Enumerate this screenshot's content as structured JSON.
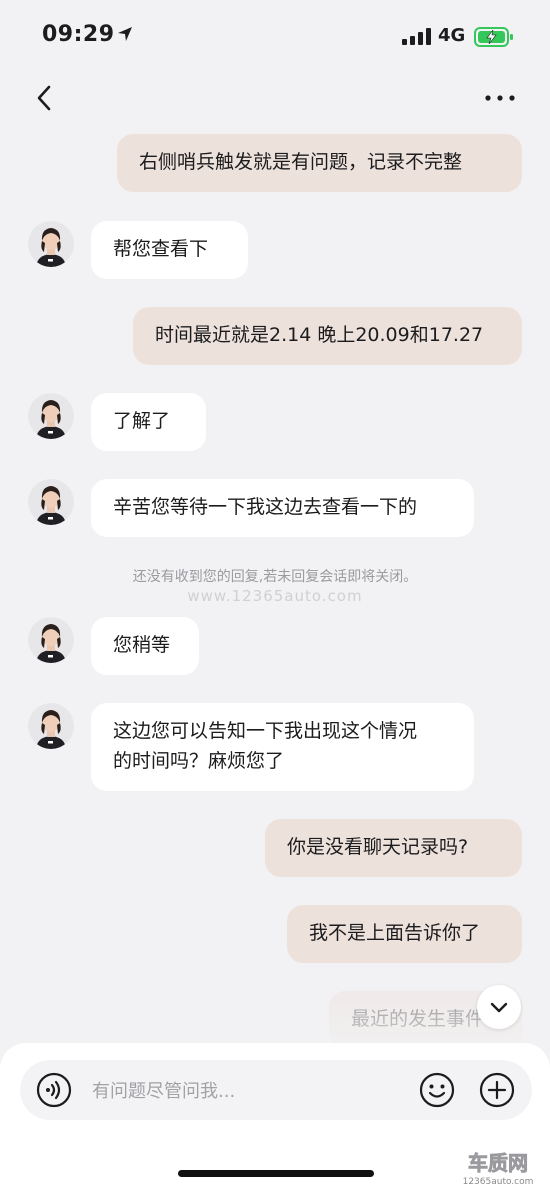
{
  "status_bar": {
    "time": "09:29",
    "network": "4G"
  },
  "nav": {
    "back_icon": "chevron-left-icon",
    "more_icon": "ellipsis-icon"
  },
  "messages": [
    {
      "from": "me",
      "text": "右侧哨兵触发就是有问题，记录不完整"
    },
    {
      "from": "agent",
      "text": "帮您查看下"
    },
    {
      "from": "me",
      "text": "时间最近就是2.14 晚上20.09和17.27"
    },
    {
      "from": "agent",
      "text": "了解了"
    },
    {
      "from": "agent",
      "text": "辛苦您等待一下我这边去查看一下的"
    },
    {
      "from": "agent",
      "text": "您稍等"
    },
    {
      "from": "agent",
      "lines": [
        "这边您可以告知一下我出现这个情况",
        "的时间吗？麻烦您了"
      ]
    },
    {
      "from": "me",
      "text": "你是没看聊天记录吗?"
    },
    {
      "from": "me",
      "text": "我不是上面告诉你了"
    },
    {
      "from": "me",
      "text": "最近的发生事件"
    }
  ],
  "system_notice": "还没有收到您的回复,若未回复会话即将关闭。",
  "watermark": "www.12365auto.com",
  "input": {
    "placeholder": "有问题尽管问我..."
  },
  "logo": {
    "main": "车质网",
    "sub": "12365auto.com"
  },
  "colors": {
    "my_bubble": "#ede1db",
    "agent_bubble": "#ffffff",
    "background": "#f2f2f4",
    "battery": "#34c759"
  }
}
